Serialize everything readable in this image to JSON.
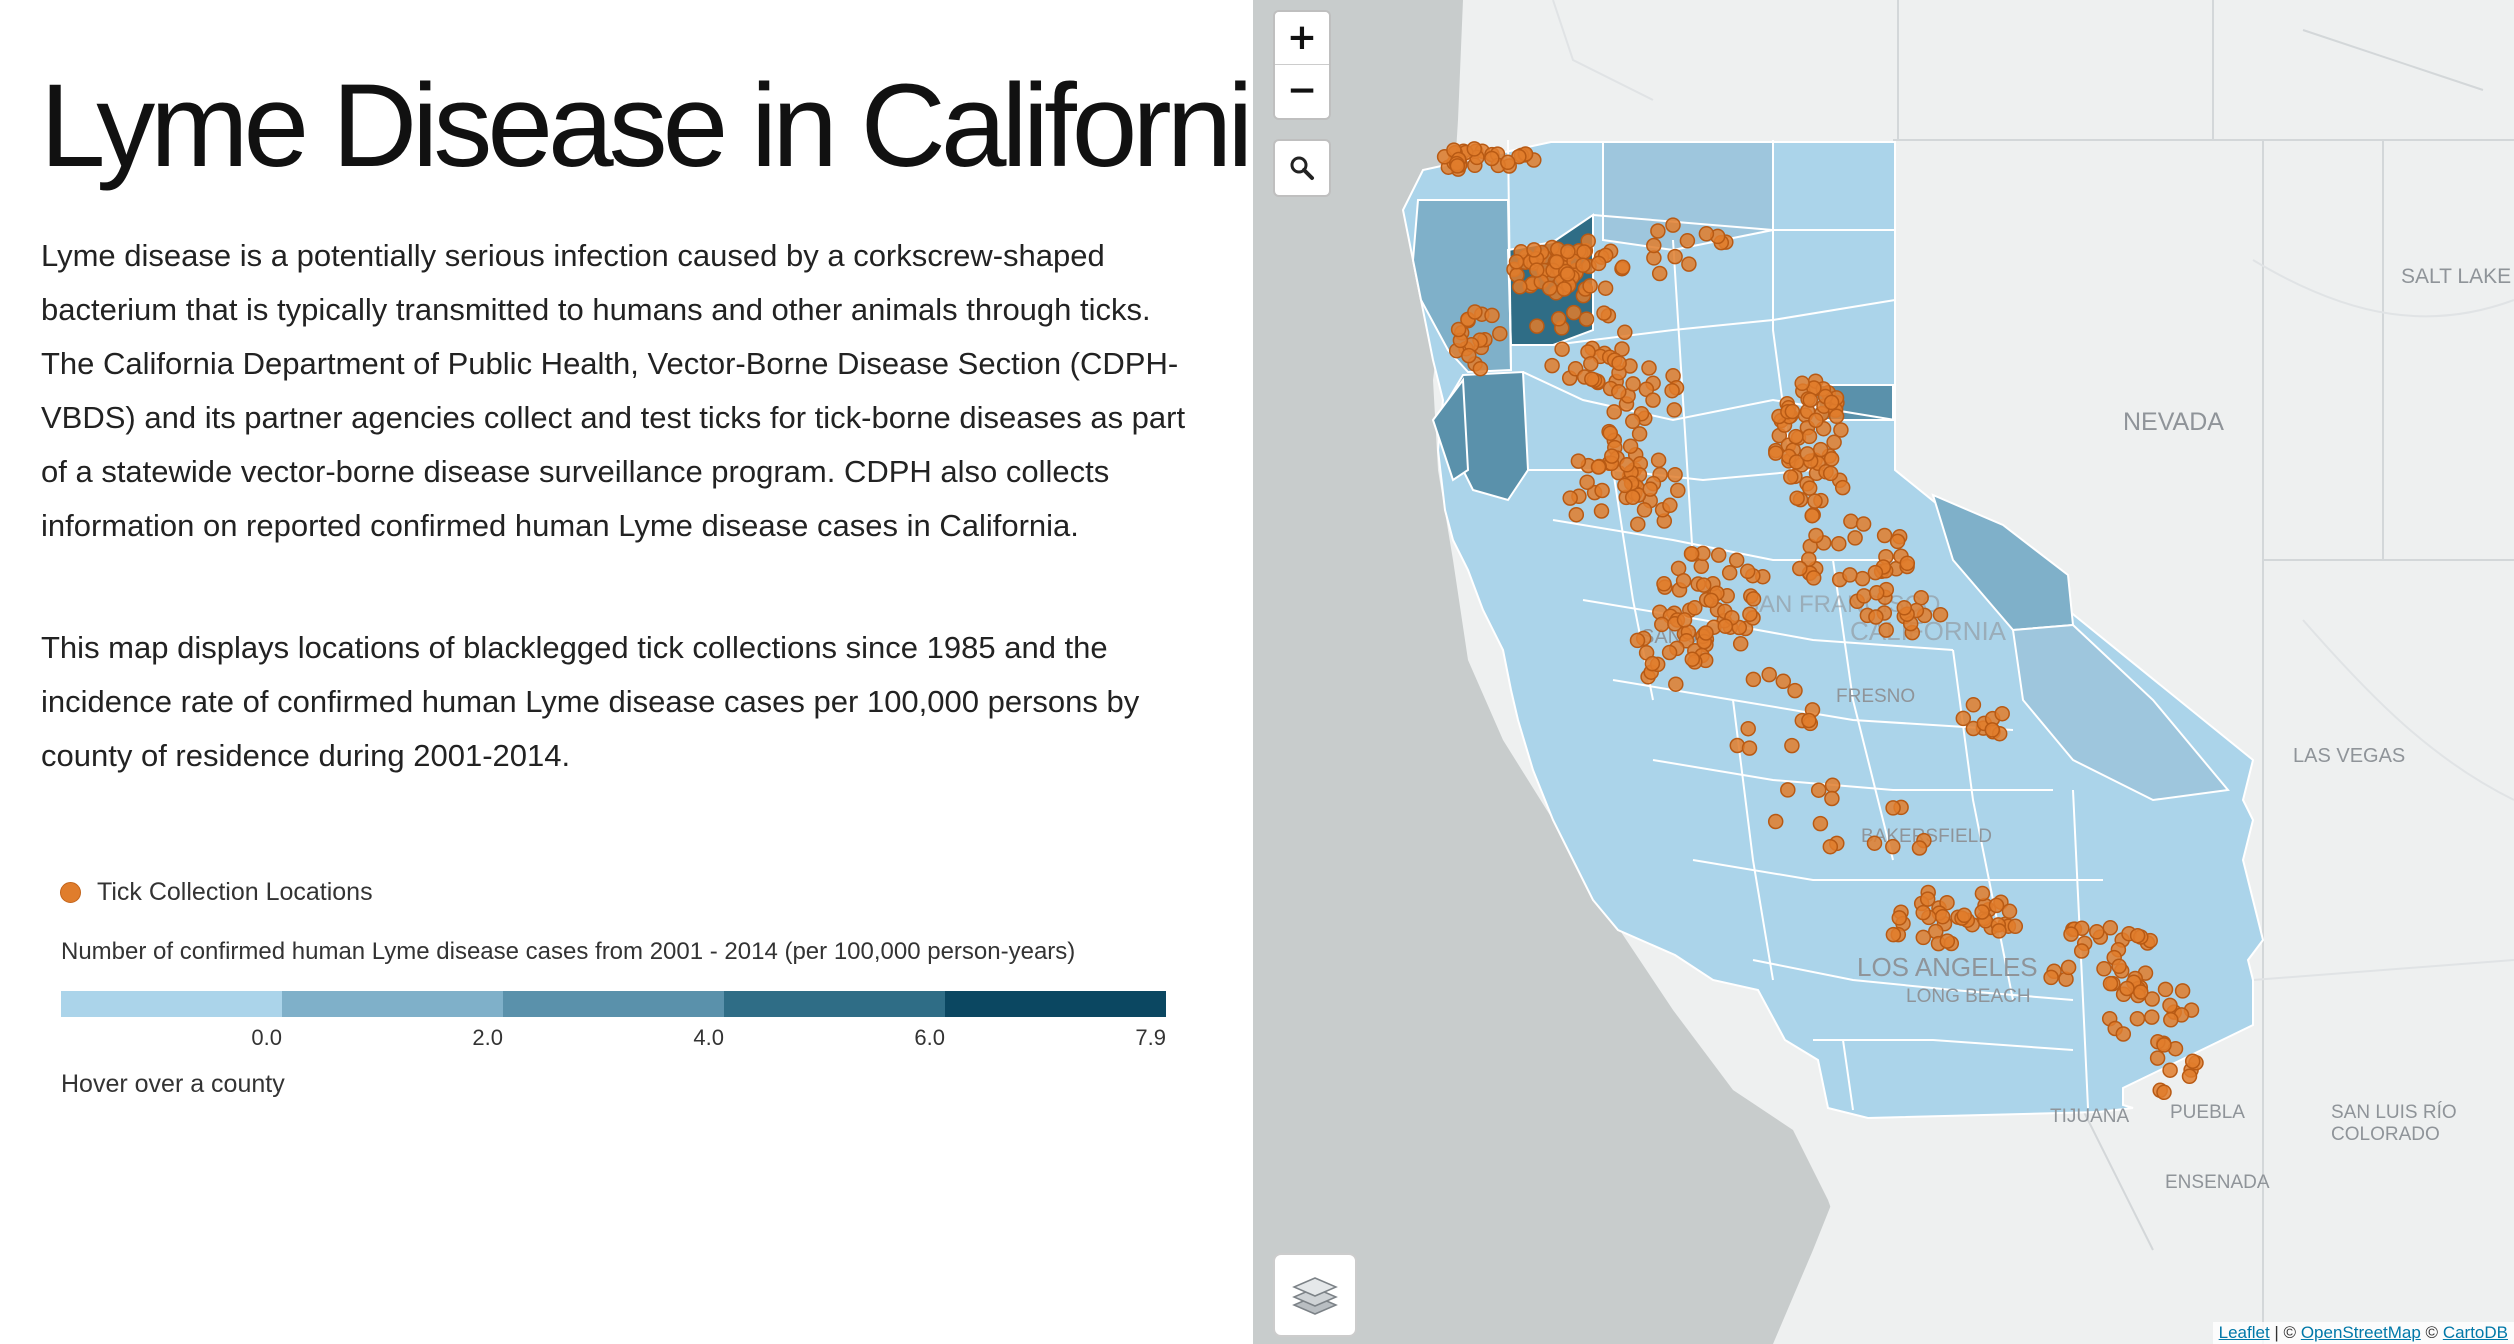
{
  "title": "Lyme Disease in California",
  "intro_paragraph": "Lyme disease is a potentially serious infection caused by a corkscrew-shaped bacterium that is typically transmitted to humans and other animals through ticks. The California Department of Public Health, Vector-Borne Disease Section (CDPH-VBDS) and its partner agencies collect and test ticks for tick-borne diseases as part of a statewide vector-borne disease surveillance program. CDPH also collects information on reported confirmed human Lyme disease cases in California.",
  "map_paragraph": "This map displays locations of blacklegged tick collections since 1985 and the incidence rate of confirmed human Lyme disease cases per 100,000 persons by county of residence during 2001-2014.",
  "legend": {
    "dot_label": "Tick Collection Locations",
    "dot_color": "#e07d2c",
    "scale_title": "Number of confirmed human Lyme disease cases from 2001 - 2014 (per 100,000 person-years)",
    "scale_colors": [
      "#abd4ea",
      "#7fb0c9",
      "#5a91ab",
      "#2f6d86",
      "#0b4761"
    ],
    "scale_ticks": [
      "0.0",
      "2.0",
      "4.0",
      "6.0",
      "7.9"
    ],
    "hover_text": "Hover over a county"
  },
  "map": {
    "zoom_in_label": "+",
    "zoom_out_label": "−",
    "search_icon": "magnifier-icon",
    "layers_icon": "layers-icon",
    "place_labels": [
      "NEVADA",
      "SALT LAKE C",
      "LAS VEGAS",
      "SAN FRANCISCO",
      "SAN JO",
      "CALIFORNIA",
      "FRESNO",
      "BAKERSFIELD",
      "LOS ANGELES",
      "LONG BEACH",
      "TIJUANA",
      "PUEBLA",
      "SAN LUIS RÍO",
      "COLORADO",
      "ENSENADA"
    ],
    "attribution": {
      "leaflet": "Leaflet",
      "sep1": " | © ",
      "osm": "OpenStreetMap",
      "sep2": " © ",
      "carto": "CartoDB"
    }
  }
}
